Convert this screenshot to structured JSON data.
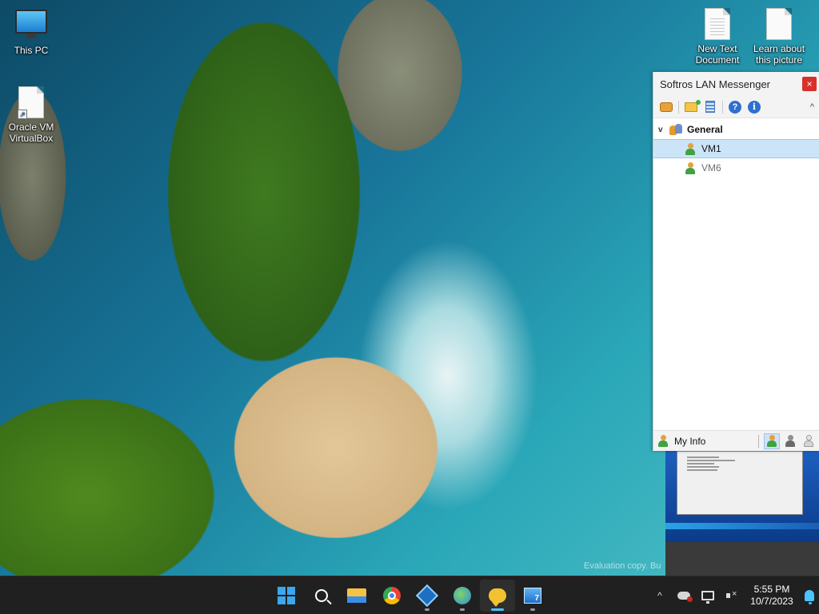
{
  "desktop": {
    "icons": [
      {
        "label": "This PC",
        "icon": "monitor-icon"
      },
      {
        "label": "Oracle VM VirtualBox",
        "icon": "shortcut-file-icon"
      },
      {
        "label": "New Text Document",
        "icon": "text-document-icon"
      },
      {
        "label": "Learn about this picture",
        "icon": "document-icon"
      }
    ],
    "watermark": "Evaluation copy. Bu"
  },
  "messenger": {
    "title": "Softros LAN Messenger",
    "close_symbol": "×",
    "toolbar": {
      "icons": [
        "messages-icon",
        "open-folder-icon",
        "message-log-icon",
        "help-icon",
        "about-icon"
      ],
      "help_symbol": "?",
      "info_symbol": "i",
      "collapse_symbol": "^"
    },
    "tree": {
      "group": {
        "name": "General",
        "expanded": true,
        "chevron": "v"
      },
      "users": [
        {
          "name": "VM1",
          "selected": true,
          "status": "online"
        },
        {
          "name": "VM6",
          "selected": false,
          "status": "offline"
        }
      ]
    },
    "status_bar": {
      "label": "My Info",
      "statuses": [
        "online",
        "busy",
        "away"
      ],
      "active_status": "online"
    }
  },
  "taskbar": {
    "apps": [
      {
        "name": "Start",
        "icon": "windows-icon"
      },
      {
        "name": "Search",
        "icon": "search-icon"
      },
      {
        "name": "File Explorer",
        "icon": "folder-icon"
      },
      {
        "name": "Google Chrome",
        "icon": "chrome-icon"
      },
      {
        "name": "Oracle VM VirtualBox",
        "icon": "virtualbox-icon"
      },
      {
        "name": "Network app",
        "icon": "globe-icon"
      },
      {
        "name": "Softros LAN Messenger",
        "icon": "chat-icon",
        "active": true
      },
      {
        "name": "Virtual Machine",
        "icon": "vm-icon"
      }
    ],
    "tray": {
      "chevron": "^",
      "time": "5:55 PM",
      "date": "10/7/2023"
    }
  },
  "colors": {
    "taskbar_bg": "#202020",
    "selection_bg": "#cce4f7",
    "close_red": "#d9302a",
    "accent": "#4cc2ff"
  }
}
